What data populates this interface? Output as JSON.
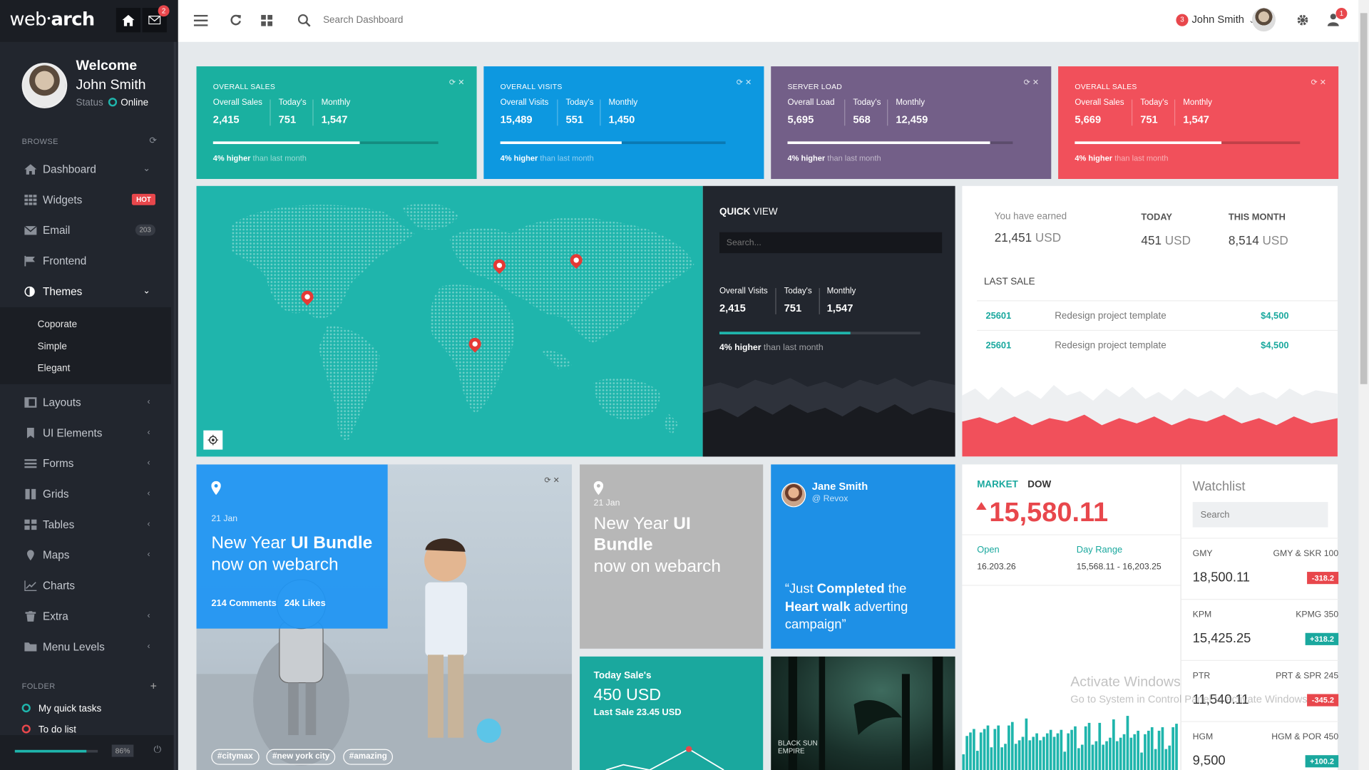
{
  "sidebar": {
    "logo_a": "web",
    "logo_b": "arch",
    "mail_badge": "2",
    "welcome": "Welcome",
    "username": "John Smith",
    "status_label": "Status",
    "status_value": "Online",
    "browse_title": "BROWSE",
    "items": [
      {
        "label": "Dashboard"
      },
      {
        "label": "Widgets",
        "badge": "HOT"
      },
      {
        "label": "Email",
        "badge": "203"
      },
      {
        "label": "Frontend"
      },
      {
        "label": "Themes"
      },
      {
        "label": "Layouts"
      },
      {
        "label": "UI Elements"
      },
      {
        "label": "Forms"
      },
      {
        "label": "Grids"
      },
      {
        "label": "Tables"
      },
      {
        "label": "Maps"
      },
      {
        "label": "Charts"
      },
      {
        "label": "Extra"
      },
      {
        "label": "Menu Levels"
      }
    ],
    "themes_sub": [
      "Coporate",
      "Simple",
      "Elegant"
    ],
    "folder_title": "FOLDER",
    "folders": [
      "My quick tasks",
      "To do list"
    ],
    "progress_pct": "86%",
    "progress_value": 0.86
  },
  "header": {
    "search_placeholder": "Search Dashboard",
    "user_badge": "3",
    "user_name": "John Smith",
    "notif_badge": "1"
  },
  "tiles": [
    {
      "title": "OVERALL SALES",
      "color": "#1ab0a0",
      "s1l": "Overall Sales",
      "s1v": "2,415",
      "s2l": "Today's",
      "s2v": "751",
      "s3l": "Monthly",
      "s3v": "1,547",
      "progress": 0.65,
      "foot_b": "4% higher",
      "foot_s": "than last month"
    },
    {
      "title": "OVERALL VISITS",
      "color": "#0d98e0",
      "s1l": "Overall Visits",
      "s1v": "15,489",
      "s2l": "Today's",
      "s2v": "551",
      "s3l": "Monthly",
      "s3v": "1,450",
      "progress": 0.54,
      "foot_b": "4% higher",
      "foot_s": "than last month"
    },
    {
      "title": "SERVER LOAD",
      "color": "#735f88",
      "s1l": "Overall Load",
      "s1v": "5,695",
      "s2l": "Today's",
      "s2v": "568",
      "s3l": "Monthly",
      "s3v": "12,459",
      "progress": 0.9,
      "foot_b": "4% higher",
      "foot_s": "than last month"
    },
    {
      "title": "OVERALL SALES",
      "color": "#f1505b",
      "s1l": "Overall Sales",
      "s1v": "5,669",
      "s2l": "Today's",
      "s2v": "751",
      "s3l": "Monthly",
      "s3v": "1,547",
      "progress": 0.65,
      "foot_b": "4% higher",
      "foot_s": "than last month"
    }
  ],
  "quickview": {
    "title_b": "QUICK",
    "title_s": "VIEW",
    "search_placeholder": "Search...",
    "s1l": "Overall Visits",
    "s1v": "2,415",
    "s2l": "Today's",
    "s2v": "751",
    "s3l": "Monthly",
    "s3v": "1,547",
    "progress": 0.65,
    "foot_b": "4% higher",
    "foot_s": "than last month"
  },
  "earnings": {
    "earned_label": "You have earned",
    "earned_value": "21,451",
    "currency": "USD",
    "today_label": "TODAY",
    "today_value": "451",
    "month_label": "THIS MONTH",
    "month_value": "8,514",
    "last_sale_title": "LAST SALE",
    "sales": [
      {
        "id": "25601",
        "desc": "Redesign project template",
        "amount": "$4,500"
      },
      {
        "id": "25601",
        "desc": "Redesign project template",
        "amount": "$4,500"
      }
    ]
  },
  "photo_card": {
    "date": "21 Jan",
    "line1_a": "New Year ",
    "line1_b": "UI Bundle",
    "line2": "now on webarch",
    "comments": "214 Comments",
    "likes": "24k Likes",
    "tags": [
      "#citymax",
      "#new york city",
      "#amazing"
    ]
  },
  "grey_card": {
    "date": "21 Jan",
    "line1_a": "New Year ",
    "line1_b": "UI",
    "line2": "Bundle",
    "line3": "now on webarch"
  },
  "tweet": {
    "name": "Jane Smith",
    "handle": "@ Revox",
    "q1": "“Just ",
    "q2": "Completed",
    "q3": " the",
    "q4": "Heart walk",
    "q5": " adverting",
    "q6": "campaign”"
  },
  "today_sale": {
    "title": "Today Sale's",
    "value": "450 USD",
    "last": "Last Sale 23.45 USD"
  },
  "forest_text": "BLACK SUN EMPIRE",
  "market": {
    "label": "MARKET",
    "index": "DOW",
    "value": "15,580.11",
    "open_label": "Open",
    "open_value": "16.203.26",
    "range_label": "Day Range",
    "range_value": "15,568.11 - 16,203.25"
  },
  "watchlist": {
    "title": "Watchlist",
    "search_placeholder": "Search",
    "rows": [
      {
        "sym": "GMY",
        "pair": "GMY & SKR 100",
        "price": "18,500.11",
        "chg": "-318.2",
        "color": "#e8474c"
      },
      {
        "sym": "KPM",
        "pair": "KPMG 350",
        "price": "15,425.25",
        "chg": "+318.2",
        "color": "#1aa89e"
      },
      {
        "sym": "PTR",
        "pair": "PRT & SPR 245",
        "price": "11,540.11",
        "chg": "-345.2",
        "color": "#e8474c"
      },
      {
        "sym": "HGM",
        "pair": "HGM & POR 450",
        "price": "9,500",
        "chg": "+100.2",
        "color": "#1aa89e"
      }
    ]
  },
  "watermark": {
    "line1": "Activate Windows",
    "line2": "Go to System in Control Panel to activate Windows."
  }
}
